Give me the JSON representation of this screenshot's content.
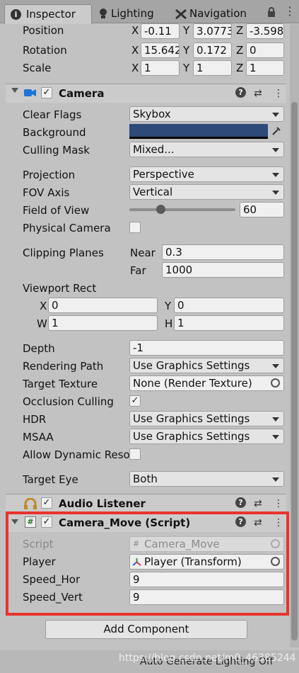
{
  "tabs": [
    {
      "label": "Inspector",
      "icon": "info-icon",
      "active": true
    },
    {
      "label": "Lighting",
      "icon": "bulb-icon",
      "active": false
    },
    {
      "label": "Navigation",
      "icon": "navigation-icon",
      "active": false
    }
  ],
  "transform": {
    "position": {
      "label": "Position",
      "x": "-0.11",
      "y": "3.0773",
      "z": "-3.598"
    },
    "rotation": {
      "label": "Rotation",
      "x": "15.642",
      "y": "0.172",
      "z": "0"
    },
    "scale": {
      "label": "Scale",
      "x": "1",
      "y": "1",
      "z": "1"
    },
    "axis_x": "X",
    "axis_y": "Y",
    "axis_z": "Z"
  },
  "camera": {
    "title": "Camera",
    "clear_flags": {
      "label": "Clear Flags",
      "value": "Skybox"
    },
    "background": {
      "label": "Background",
      "color": "#2d4a78"
    },
    "culling_mask": {
      "label": "Culling Mask",
      "value": "Mixed..."
    },
    "projection": {
      "label": "Projection",
      "value": "Perspective"
    },
    "fov_axis": {
      "label": "FOV Axis",
      "value": "Vertical"
    },
    "field_of_view": {
      "label": "Field of View",
      "value": "60",
      "slider_fraction": 0.29
    },
    "physical_camera": {
      "label": "Physical Camera",
      "checked": false
    },
    "clipping_planes": {
      "label": "Clipping Planes",
      "near_label": "Near",
      "near": "0.3",
      "far_label": "Far",
      "far": "1000"
    },
    "viewport_rect": {
      "label": "Viewport Rect",
      "x_label": "X",
      "x": "0",
      "y_label": "Y",
      "y": "0",
      "w_label": "W",
      "w": "1",
      "h_label": "H",
      "h": "1"
    },
    "depth": {
      "label": "Depth",
      "value": "-1"
    },
    "rendering_path": {
      "label": "Rendering Path",
      "value": "Use Graphics Settings"
    },
    "target_texture": {
      "label": "Target Texture",
      "value": "None (Render Texture)"
    },
    "occlusion_culling": {
      "label": "Occlusion Culling",
      "checked": true
    },
    "hdr": {
      "label": "HDR",
      "value": "Use Graphics Settings"
    },
    "msaa": {
      "label": "MSAA",
      "value": "Use Graphics Settings"
    },
    "allow_dynamic": {
      "label": "Allow Dynamic Reso",
      "checked": false
    },
    "target_eye": {
      "label": "Target Eye",
      "value": "Both"
    }
  },
  "audio_listener": {
    "title": "Audio Listener"
  },
  "camera_move": {
    "title": "Camera_Move (Script)",
    "script": {
      "label": "Script",
      "value": "Camera_Move"
    },
    "player": {
      "label": "Player",
      "value": "Player (Transform)"
    },
    "speed_hor": {
      "label": "Speed_Hor",
      "value": "9"
    },
    "speed_vert": {
      "label": "Speed_Vert",
      "value": "9"
    }
  },
  "add_component_label": "Add Component",
  "footer": {
    "status": "Auto Generate Lighting Off",
    "watermark": "https://blog.csdn.net/m0_46385244"
  },
  "colors": {
    "highlight_box": "#e8332e",
    "background_swatch": "#2d4a78"
  }
}
